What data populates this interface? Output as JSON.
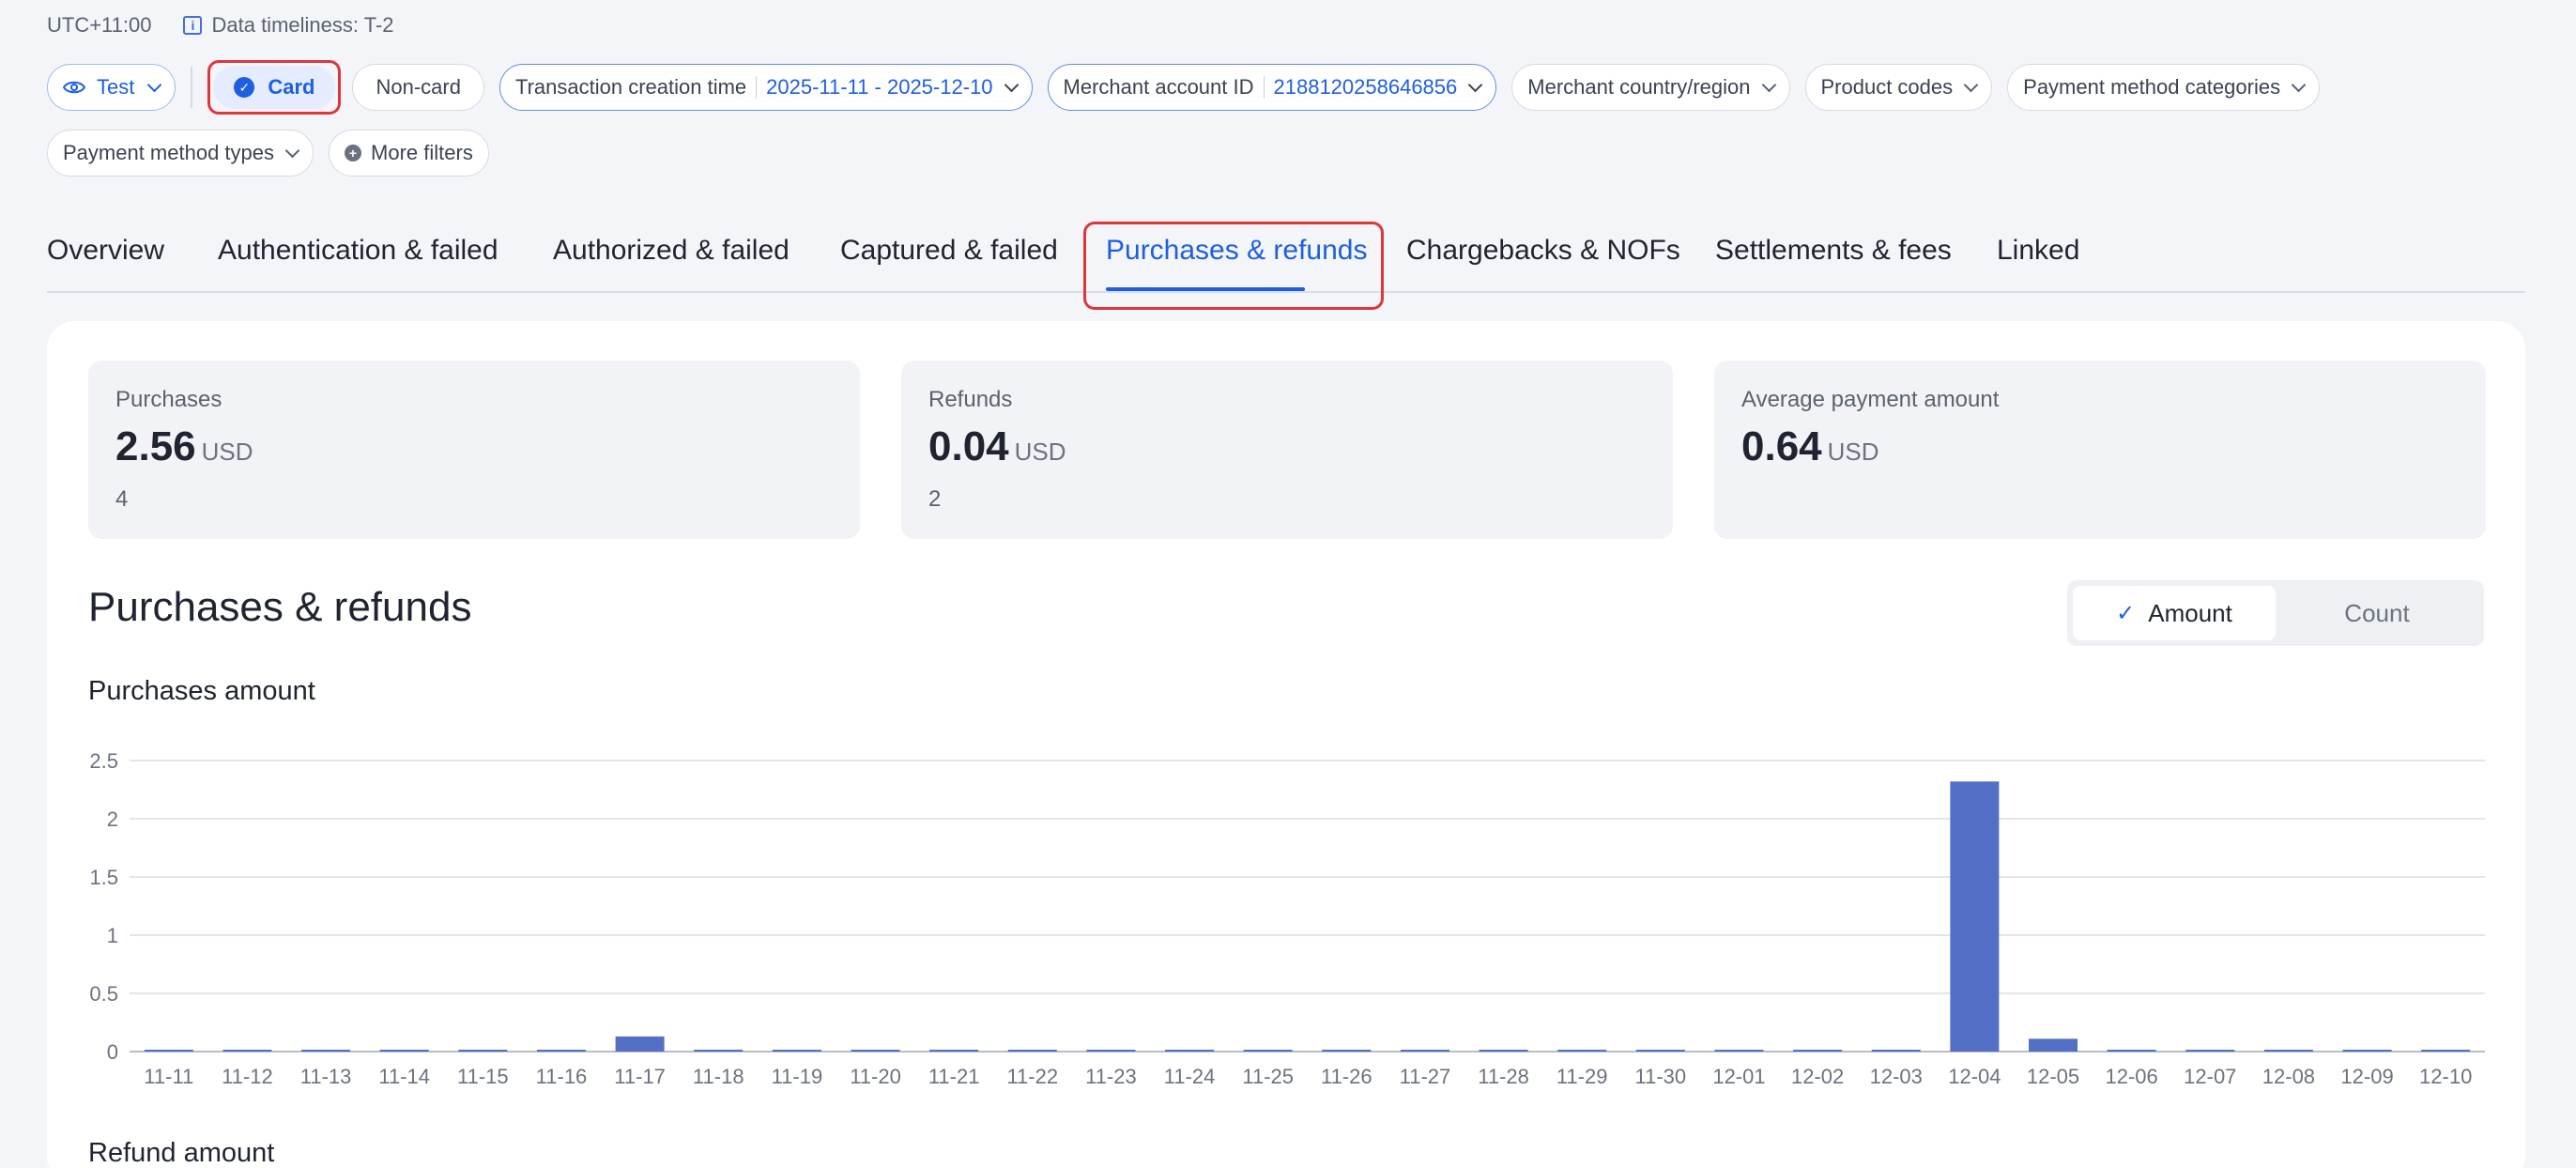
{
  "header": {
    "timezone": "UTC+11:00",
    "timeliness": "Data timeliness: T-2"
  },
  "filters": {
    "env": "Test",
    "card_label": "Card",
    "noncard_label": "Non-card",
    "txn_time_label": "Transaction creation time",
    "txn_time_value": "2025-11-11 - 2025-12-10",
    "merchant_id_label": "Merchant account ID",
    "merchant_id_value": "2188120258646856",
    "country": "Merchant country/region",
    "product_codes": "Product codes",
    "pm_categories": "Payment method categories",
    "pm_types": "Payment method types",
    "more_filters": "More filters"
  },
  "tabs": [
    {
      "label": "Overview"
    },
    {
      "label": "Authentication & failed"
    },
    {
      "label": "Authorized & failed"
    },
    {
      "label": "Captured & failed"
    },
    {
      "label": "Purchases & refunds"
    },
    {
      "label": "Chargebacks & NOFs"
    },
    {
      "label": "Settlements & fees"
    },
    {
      "label": "Linked"
    }
  ],
  "active_tab": "Purchases & refunds",
  "stats": {
    "purchases": {
      "label": "Purchases",
      "value": "2.56",
      "unit": "USD",
      "count": "4"
    },
    "refunds": {
      "label": "Refunds",
      "value": "0.04",
      "unit": "USD",
      "count": "2"
    },
    "average": {
      "label": "Average payment amount",
      "value": "0.64",
      "unit": "USD"
    }
  },
  "section": {
    "title": "Purchases & refunds",
    "toggle_amount": "Amount",
    "toggle_count": "Count",
    "toggle_selected": "Amount"
  },
  "charts": {
    "purchases_title": "Purchases amount",
    "refunds_title": "Refund amount"
  },
  "colors": {
    "accent": "#1d5fe0",
    "bar": "#5470c6",
    "highlight": "#e0363a"
  },
  "chart_data": {
    "type": "bar",
    "title": "Purchases amount",
    "xlabel": "",
    "ylabel": "",
    "ylim": [
      0,
      2.5
    ],
    "yticks": [
      "0",
      "0.5",
      "1",
      "1.5",
      "2",
      "2.5"
    ],
    "grid": true,
    "categories": [
      "11-11",
      "11-12",
      "11-13",
      "11-14",
      "11-15",
      "11-16",
      "11-17",
      "11-18",
      "11-19",
      "11-20",
      "11-21",
      "11-22",
      "11-23",
      "11-24",
      "11-25",
      "11-26",
      "11-27",
      "11-28",
      "11-29",
      "11-30",
      "12-01",
      "12-02",
      "12-03",
      "12-04",
      "12-05",
      "12-06",
      "12-07",
      "12-08",
      "12-09",
      "12-10"
    ],
    "values": [
      0,
      0,
      0,
      0,
      0,
      0,
      0.13,
      0,
      0,
      0,
      0,
      0,
      0,
      0,
      0,
      0,
      0,
      0,
      0,
      0,
      0,
      0,
      0,
      2.32,
      0.11,
      0,
      0,
      0,
      0,
      0
    ]
  }
}
